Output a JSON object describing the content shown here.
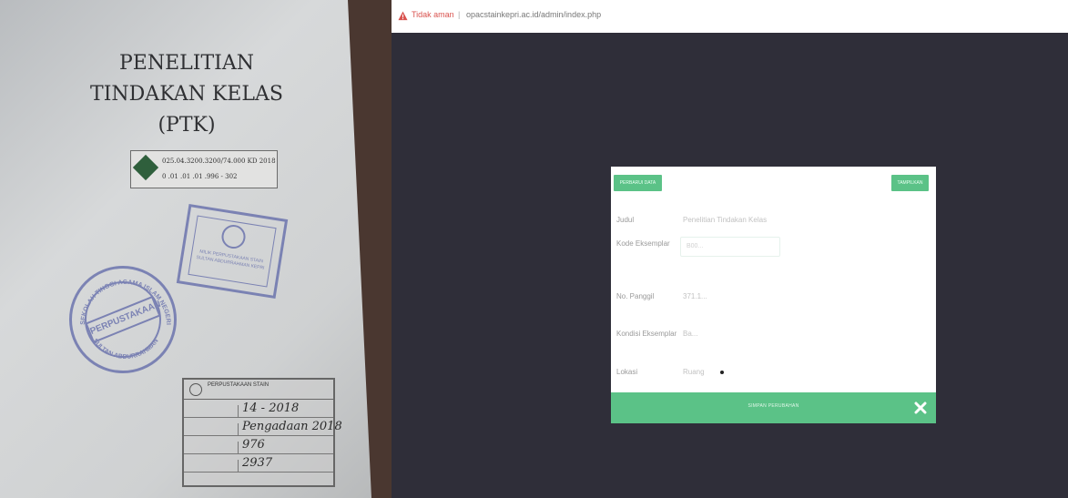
{
  "book": {
    "title_line1": "PENELITIAN",
    "title_line2": "TINDAKAN KELAS",
    "title_line3": "(PTK)",
    "call_number_line1": "025.04.3200.3200/74.000 KD 2018",
    "call_number_line2": "0 .01 .01 .01 .996 - 302",
    "round_stamp_center": "PERPUSTAKAAN",
    "round_stamp_ring_top": "SEKOLAH TINGGI AGAMA ISLAM NEGERI",
    "round_stamp_ring_bottom": "SULTAN ABDURRAHMAN",
    "rect_stamp_text": "MILIK PERPUSTAKAAN STAIN SULTAN ABDURRAHMAN KEPRI",
    "inventory_header": "PERPUSTAKAAN STAIN",
    "inventory_date": "14 - 2018",
    "inventory_source": "Pengadaan 2018",
    "inventory_no_1": "976",
    "inventory_no_2": "2937"
  },
  "browser": {
    "security_label": "Tidak aman",
    "url": "opacstainkepri.ac.id/admin/index.php"
  },
  "modal": {
    "header_left_button": "PERBARUI DATA",
    "header_right_button": "TAMPILKAN",
    "fields": {
      "judul_label": "Judul",
      "judul_value": "Penelitian Tindakan Kelas",
      "kode_label": "Kode Eksemplar",
      "kode_value": "B00...",
      "no_label": "No. Panggil",
      "no_value": "371.1...",
      "kondisi_label": "Kondisi Eksemplar",
      "kondisi_value": "Ba...",
      "lokasi_label": "Lokasi",
      "lokasi_value": "Ruang"
    },
    "save_label": "SIMPAN PERUBAHAN"
  },
  "colors": {
    "accent": "#5bc287",
    "overlay": "#2f2e39",
    "warning": "#d9534f"
  }
}
